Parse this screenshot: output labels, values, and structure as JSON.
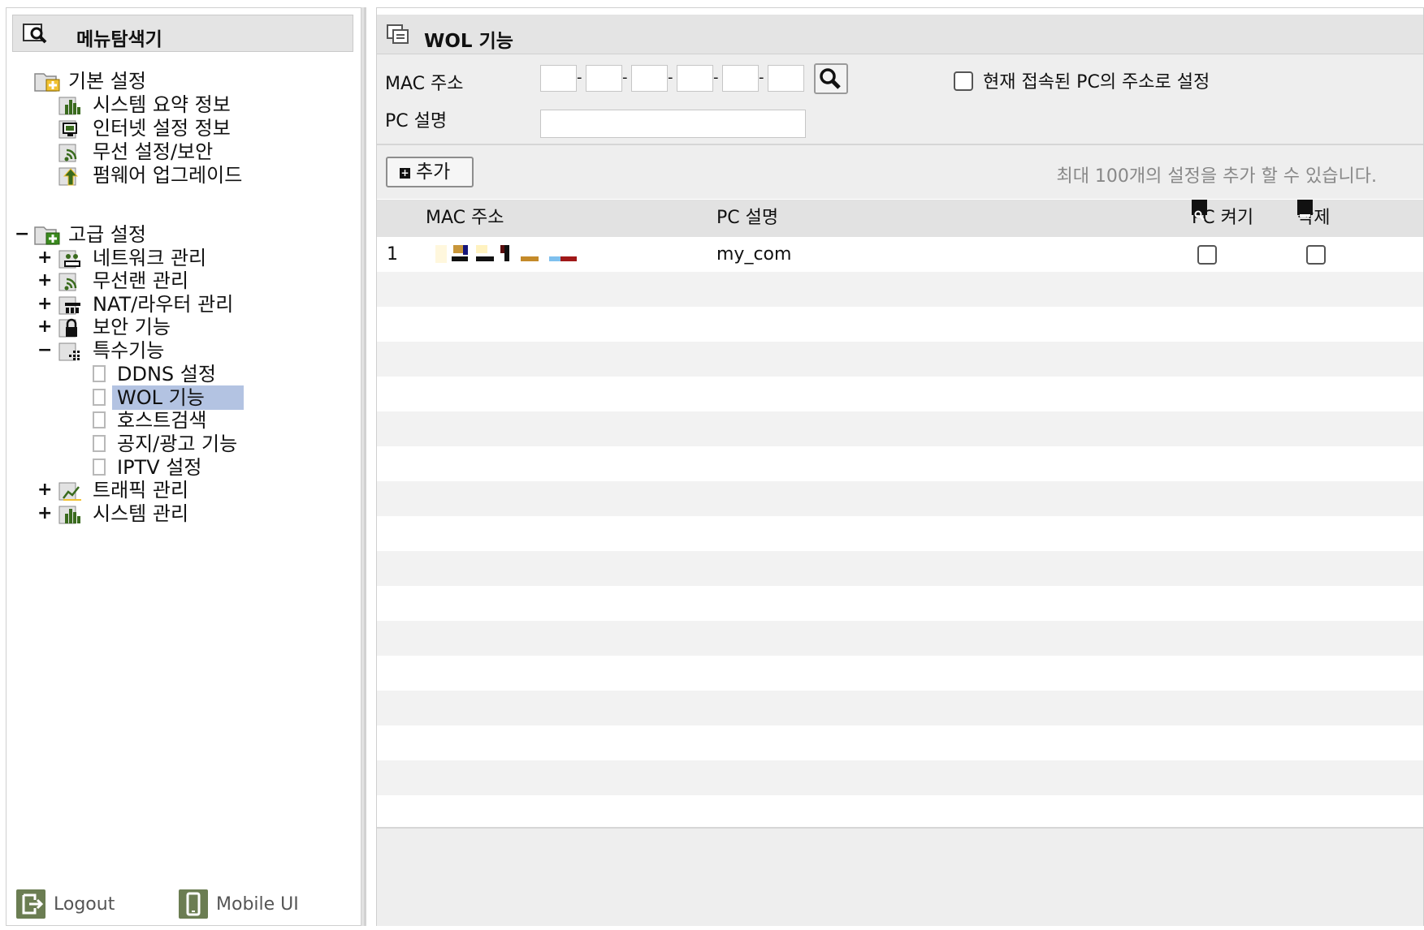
{
  "sidebar": {
    "title": "메뉴탐색기",
    "basic": {
      "label": "기본 설정",
      "items": [
        {
          "label": "시스템 요약 정보",
          "icon": "bar-chart-icon"
        },
        {
          "label": "인터넷 설정 정보",
          "icon": "monitor-icon"
        },
        {
          "label": "무선 설정/보안",
          "icon": "wireless-icon"
        },
        {
          "label": "펌웨어 업그레이드",
          "icon": "upgrade-arrow-icon"
        }
      ]
    },
    "advanced": {
      "label": "고급 설정",
      "items": [
        {
          "label": "네트워크 관리",
          "toggle": "+"
        },
        {
          "label": "무선랜 관리",
          "toggle": "+"
        },
        {
          "label": "NAT/라우터 관리",
          "toggle": "+"
        },
        {
          "label": "보안 기능",
          "toggle": "+"
        },
        {
          "label": "특수기능",
          "toggle": "−"
        }
      ],
      "special_children": [
        "DDNS 설정",
        "WOL 기능",
        "호스트검색",
        "공지/광고 기능",
        "IPTV 설정"
      ],
      "more_items": [
        {
          "label": "트래픽 관리",
          "toggle": "+"
        },
        {
          "label": "시스템 관리",
          "toggle": "+"
        }
      ],
      "toggle": "−"
    },
    "footer": {
      "logout": "Logout",
      "mobile": "Mobile UI"
    }
  },
  "main": {
    "title": "WOL 기능",
    "form": {
      "mac_label": "MAC 주소",
      "mac_separator": "-",
      "current_pc_label": "현재 접속된 PC의 주소로 설정",
      "pc_desc_label": "PC 설명",
      "pc_desc_value": ""
    },
    "add_button": "추가",
    "notice": "최대 100개의 설정을 추가 할 수 있습니다.",
    "table": {
      "headers": {
        "mac": "MAC 주소",
        "desc": "PC 설명",
        "power": "PC 켜기",
        "delete": "삭제"
      },
      "rows": [
        {
          "index": "1",
          "desc": "my_com"
        }
      ]
    }
  },
  "colors": {
    "header_bg": "#e4e4e4",
    "active_item": "#b3c3e2",
    "footer_icon": "#6b7d52"
  }
}
